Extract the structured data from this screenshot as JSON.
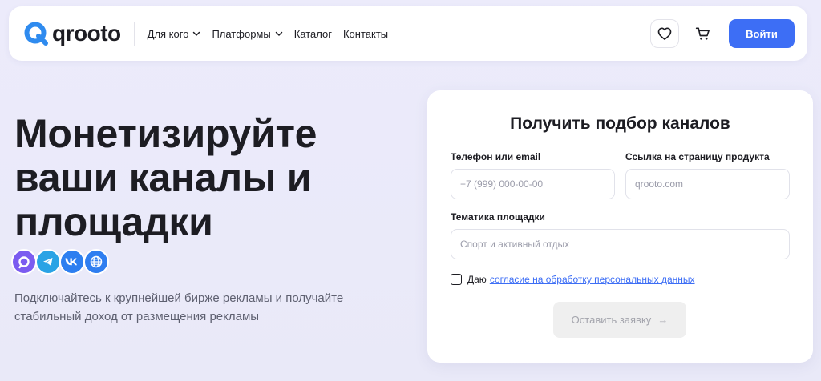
{
  "header": {
    "logo_text": "qrooto",
    "nav": [
      {
        "label": "Для кого",
        "has_dropdown": true
      },
      {
        "label": "Платформы",
        "has_dropdown": true
      },
      {
        "label": "Каталог",
        "has_dropdown": false
      },
      {
        "label": "Контакты",
        "has_dropdown": false
      }
    ],
    "login_label": "Войти",
    "icons": [
      "heart-icon",
      "cart-icon"
    ]
  },
  "hero": {
    "title": "Монетизируйте ваши каналы и площадки",
    "subtitle": "Подключайтесь к крупнейшей бирже рекламы и получайте стабильный доход от размещения рекламы",
    "platform_icons": [
      "max-icon",
      "telegram-icon",
      "vk-icon",
      "web-icon"
    ]
  },
  "form": {
    "title": "Получить подбор каналов",
    "contact": {
      "label": "Телефон или email",
      "placeholder": "+7 (999) 000-00-00",
      "value": ""
    },
    "product": {
      "label": "Ссылка на страницу продукта",
      "placeholder": "qrooto.com",
      "value": ""
    },
    "topic": {
      "label": "Тематика площадки",
      "placeholder": "Спорт и активный отдых",
      "value": ""
    },
    "consent_text": "Даю",
    "consent_link": "согласие на обработку персональных данных",
    "consent_checked": false,
    "submit_label": "Оставить заявку",
    "submit_arrow": "→"
  },
  "colors": {
    "accent": "#3d6ef5",
    "logo": "#2f8bef",
    "background": "#ecebfb"
  }
}
